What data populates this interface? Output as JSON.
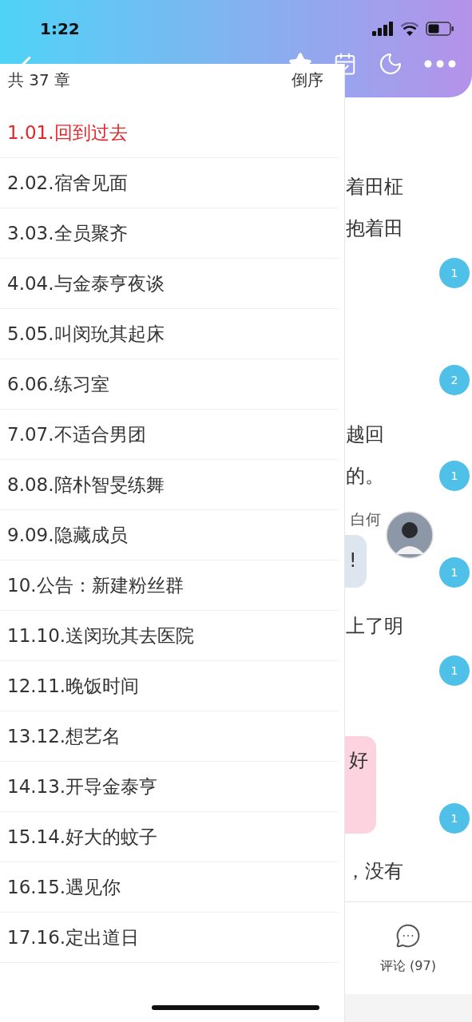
{
  "status_bar": {
    "time": "1:22"
  },
  "drawer": {
    "count": "共 37 章",
    "sort": "倒序",
    "chapters": [
      {
        "title": "1.01.回到过去",
        "selected": true
      },
      {
        "title": "2.02.宿舍见面",
        "selected": false
      },
      {
        "title": "3.03.全员聚齐",
        "selected": false
      },
      {
        "title": "4.04.与金泰亨夜谈",
        "selected": false
      },
      {
        "title": "5.05.叫闵玧其起床",
        "selected": false
      },
      {
        "title": "6.06.练习室",
        "selected": false
      },
      {
        "title": "7.07.不适合男团",
        "selected": false
      },
      {
        "title": "8.08.陪朴智旻练舞",
        "selected": false
      },
      {
        "title": "9.09.隐藏成员",
        "selected": false
      },
      {
        "title": "10.公告：新建粉丝群",
        "selected": false
      },
      {
        "title": "11.10.送闵玧其去医院",
        "selected": false
      },
      {
        "title": "12.11.晚饭时间",
        "selected": false
      },
      {
        "title": "13.12.想艺名",
        "selected": false
      },
      {
        "title": "14.13.开导金泰亨",
        "selected": false
      },
      {
        "title": "15.14.好大的蚊子",
        "selected": false
      },
      {
        "title": "16.15.遇见你",
        "selected": false
      },
      {
        "title": "17.16.定出道日",
        "selected": false
      }
    ]
  },
  "content": {
    "rows": [
      {
        "kind": "line",
        "text": "着田柾"
      },
      {
        "kind": "line",
        "text": "抱着田"
      },
      {
        "kind": "comment",
        "comments": "1"
      },
      {
        "kind": "comment",
        "comments": "2"
      },
      {
        "kind": "line",
        "text": "越回"
      },
      {
        "kind": "line",
        "text": "的。",
        "comments": "1"
      },
      {
        "kind": "message",
        "name": "白何",
        "text": "!",
        "color": "#dde6ee",
        "comments": "1"
      },
      {
        "kind": "line",
        "text": "上了明"
      },
      {
        "kind": "comment",
        "comments": "1"
      },
      {
        "kind": "message",
        "text": "好",
        "color": "#fcd3de",
        "comments": "1"
      },
      {
        "kind": "line",
        "text": "，没有"
      }
    ]
  },
  "bottom_bar": {
    "comments_label": "评论 (97)"
  }
}
